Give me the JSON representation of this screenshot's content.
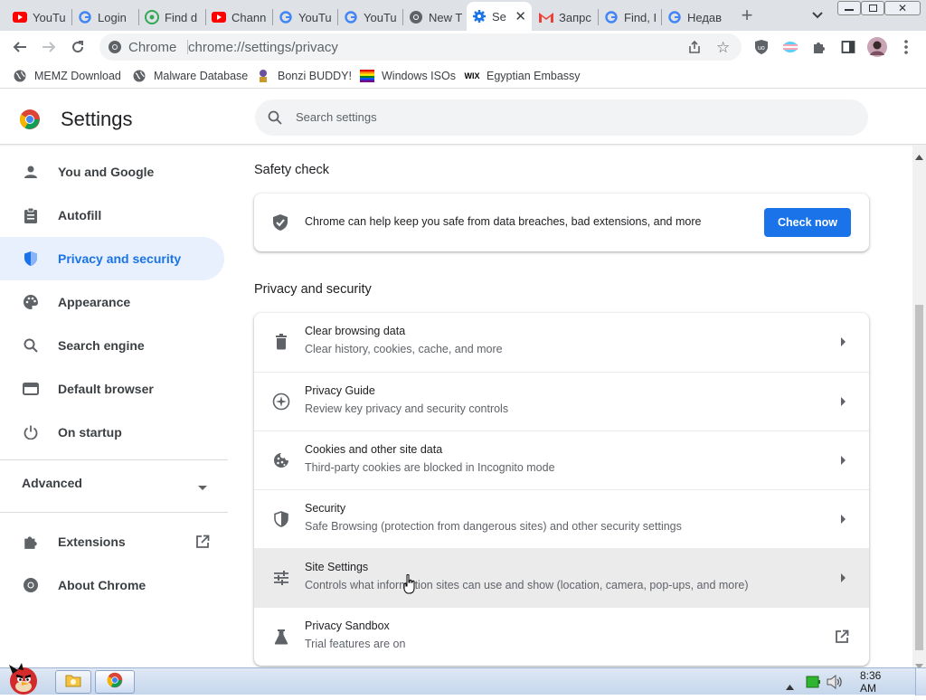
{
  "tabs": [
    {
      "title": "YouTu",
      "icon": "youtube-icon"
    },
    {
      "title": "Login",
      "icon": "google-icon"
    },
    {
      "title": "Find d",
      "icon": "find-icon"
    },
    {
      "title": "Chann",
      "icon": "youtube-icon"
    },
    {
      "title": "YouTu",
      "icon": "google-icon"
    },
    {
      "title": "YouTu",
      "icon": "google-icon"
    },
    {
      "title": "New T",
      "icon": "chrome-icon"
    },
    {
      "title": "Se",
      "icon": "settings-gear-icon",
      "active": true
    },
    {
      "title": "Запрс",
      "icon": "gmail-icon"
    },
    {
      "title": "Find, I",
      "icon": "google-icon"
    },
    {
      "title": "Недав",
      "icon": "google-icon"
    }
  ],
  "toolbar": {
    "site_label": "Chrome",
    "url": "chrome://settings/privacy"
  },
  "bookmarks": [
    {
      "label": "MEMZ Download",
      "icon": "globe-icon"
    },
    {
      "label": "Malware Database",
      "icon": "globe-icon"
    },
    {
      "label": "Bonzi BUDDY!",
      "icon": "bonzi-icon"
    },
    {
      "label": "Windows ISOs",
      "icon": "rainbow-flag-icon"
    },
    {
      "label": "Egyptian Embassy",
      "icon": "wix-icon"
    }
  ],
  "header": {
    "title": "Settings",
    "search_placeholder": "Search settings"
  },
  "nav": {
    "items": [
      {
        "label": "You and Google",
        "icon": "person-icon"
      },
      {
        "label": "Autofill",
        "icon": "clipboard-icon"
      },
      {
        "label": "Privacy and security",
        "icon": "shield-icon",
        "selected": true
      },
      {
        "label": "Appearance",
        "icon": "palette-icon"
      },
      {
        "label": "Search engine",
        "icon": "search-icon"
      },
      {
        "label": "Default browser",
        "icon": "browser-window-icon"
      },
      {
        "label": "On startup",
        "icon": "power-icon"
      }
    ],
    "advanced": "Advanced",
    "extensions": "Extensions",
    "about": "About Chrome"
  },
  "safety_check": {
    "title": "Safety check",
    "text": "Chrome can help keep you safe from data breaches, bad extensions, and more",
    "button": "Check now"
  },
  "privacy": {
    "title": "Privacy and security",
    "rows": [
      {
        "title": "Clear browsing data",
        "subtitle": "Clear history, cookies, cache, and more",
        "icon": "trash-icon"
      },
      {
        "title": "Privacy Guide",
        "subtitle": "Review key privacy and security controls",
        "icon": "compass-icon"
      },
      {
        "title": "Cookies and other site data",
        "subtitle": "Third-party cookies are blocked in Incognito mode",
        "icon": "cookie-icon"
      },
      {
        "title": "Security",
        "subtitle": "Safe Browsing (protection from dangerous sites) and other security settings",
        "icon": "shield-icon"
      },
      {
        "title": "Site Settings",
        "subtitle": "Controls what information sites can use and show (location, camera, pop-ups, and more)",
        "icon": "tune-icon",
        "hover": true
      },
      {
        "title": "Privacy Sandbox",
        "subtitle": "Trial features are on",
        "icon": "flask-icon",
        "external": true
      }
    ]
  },
  "taskbar": {
    "clock": "8:36 AM"
  },
  "colors": {
    "accent": "#1a73e8",
    "selected_bg": "#e8f0fe",
    "tab_strip": "#dee1e6"
  }
}
